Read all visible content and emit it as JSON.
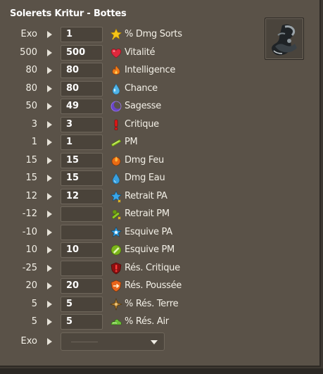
{
  "title": "Solerets Kritur - Bottes",
  "rows": [
    {
      "current": "Exo",
      "input": "1",
      "icon": "star-icon",
      "label": "% Dmg Sorts"
    },
    {
      "current": "500",
      "input": "500",
      "icon": "heart-icon",
      "label": "Vitalité"
    },
    {
      "current": "80",
      "input": "80",
      "icon": "fire-icon",
      "label": "Intelligence"
    },
    {
      "current": "80",
      "input": "80",
      "icon": "water-drop-icon",
      "label": "Chance"
    },
    {
      "current": "50",
      "input": "49",
      "icon": "moon-icon",
      "label": "Sagesse"
    },
    {
      "current": "3",
      "input": "3",
      "icon": "exclamation-icon",
      "label": "Critique"
    },
    {
      "current": "1",
      "input": "1",
      "icon": "boot-pm-icon",
      "label": "PM"
    },
    {
      "current": "15",
      "input": "15",
      "icon": "fire-damage-icon",
      "label": "Dmg Feu"
    },
    {
      "current": "15",
      "input": "15",
      "icon": "water-damage-icon",
      "label": "Dmg Eau"
    },
    {
      "current": "12",
      "input": "12",
      "icon": "star-retreat-icon",
      "label": "Retrait PA"
    },
    {
      "current": "-12",
      "input": "",
      "icon": "boot-retreat-icon",
      "label": "Retrait PM"
    },
    {
      "current": "-10",
      "input": "",
      "icon": "star-dodge-icon",
      "label": "Esquive PA"
    },
    {
      "current": "10",
      "input": "10",
      "icon": "boot-dodge-icon",
      "label": "Esquive PM"
    },
    {
      "current": "-25",
      "input": "",
      "icon": "critical-resist-icon",
      "label": "Rés. Critique"
    },
    {
      "current": "20",
      "input": "20",
      "icon": "pushback-resist-icon",
      "label": "Rés. Poussée"
    },
    {
      "current": "5",
      "input": "5",
      "icon": "earth-resist-icon",
      "label": "% Rés. Terre"
    },
    {
      "current": "5",
      "input": "5",
      "icon": "air-resist-icon",
      "label": "% Rés. Air"
    }
  ],
  "exo_row": {
    "current": "Exo",
    "selected": ""
  },
  "item_icon": "boots-item-icon"
}
